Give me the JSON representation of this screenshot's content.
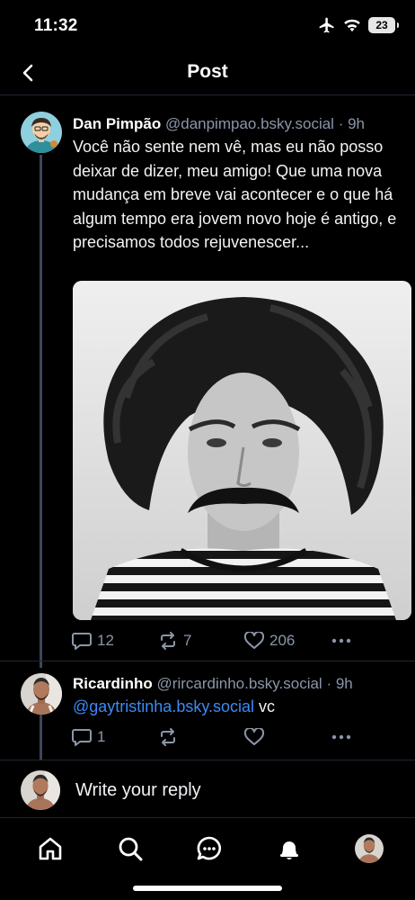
{
  "status_bar": {
    "time": "11:32",
    "battery": "23",
    "icons": [
      "airplane-icon",
      "wifi-icon",
      "battery-icon"
    ]
  },
  "header": {
    "title": "Post",
    "back_icon": "chevron-left-icon"
  },
  "post": {
    "author_name": "Dan Pimpão",
    "handle": "@danpimpao.bsky.social",
    "time": "· 9h",
    "text": "Você não sente nem vê, mas eu não posso deixar de dizer, meu amigo! Que uma nova mudança em breve vai acontecer e o que há algum tempo era jovem novo hoje é antigo, e precisamos todos rejuvenescer...",
    "image": "black-and-white portrait photo",
    "replies": "12",
    "reposts": "7",
    "likes": "206"
  },
  "reply": {
    "author_name": "Ricardinho",
    "handle": "@rircardinho.bsky.social",
    "time": "· 9h",
    "mention": "@gaytristinha.bsky.social",
    "text": "vc",
    "replies": "1"
  },
  "composer": {
    "placeholder": "Write your reply"
  },
  "nav": {
    "items": [
      "home-icon",
      "search-icon",
      "chat-icon",
      "notifications-icon",
      "profile-avatar"
    ]
  },
  "colors": {
    "background": "#000000",
    "accent": "#3c8af5",
    "muted": "#8a96a8",
    "divider": "#1f2632"
  }
}
